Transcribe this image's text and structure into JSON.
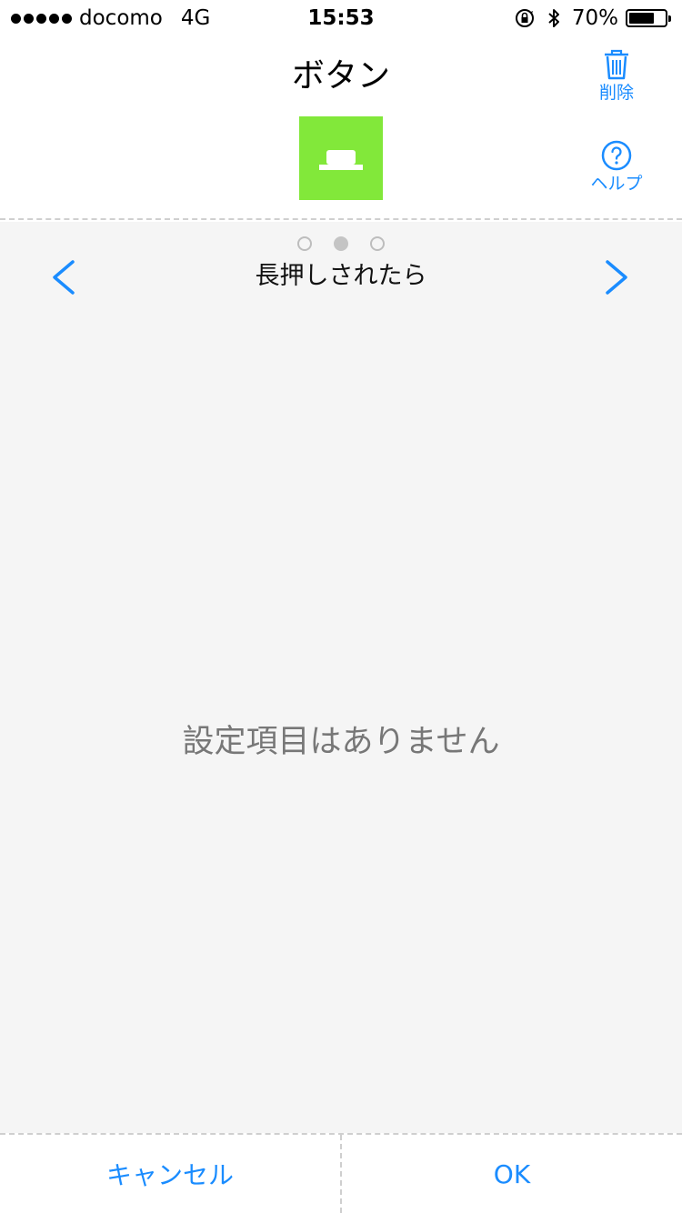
{
  "status_bar": {
    "carrier": "docomo",
    "network": "4G",
    "time": "15:53",
    "battery_percent": "70%",
    "battery_level": 0.7,
    "icons": [
      "signal-dots-icon",
      "rotation-lock-icon",
      "bluetooth-icon",
      "battery-icon"
    ]
  },
  "header": {
    "title": "ボタン",
    "thumbnail_color": "#82e83a",
    "thumbnail_icon": "button-device-icon",
    "delete_label": "削除",
    "help_label": "ヘルプ"
  },
  "pager": {
    "page_count": 3,
    "current_index": 1,
    "page_title": "長押しされたら",
    "prev_icon": "chevron-left-icon",
    "next_icon": "chevron-right-icon"
  },
  "content": {
    "empty_message": "設定項目はありません"
  },
  "footer": {
    "cancel_label": "キャンセル",
    "ok_label": "OK"
  },
  "colors": {
    "accent": "#1a8cff",
    "background": "#f5f5f5",
    "thumbnail": "#82e83a",
    "muted_text": "#777777"
  }
}
